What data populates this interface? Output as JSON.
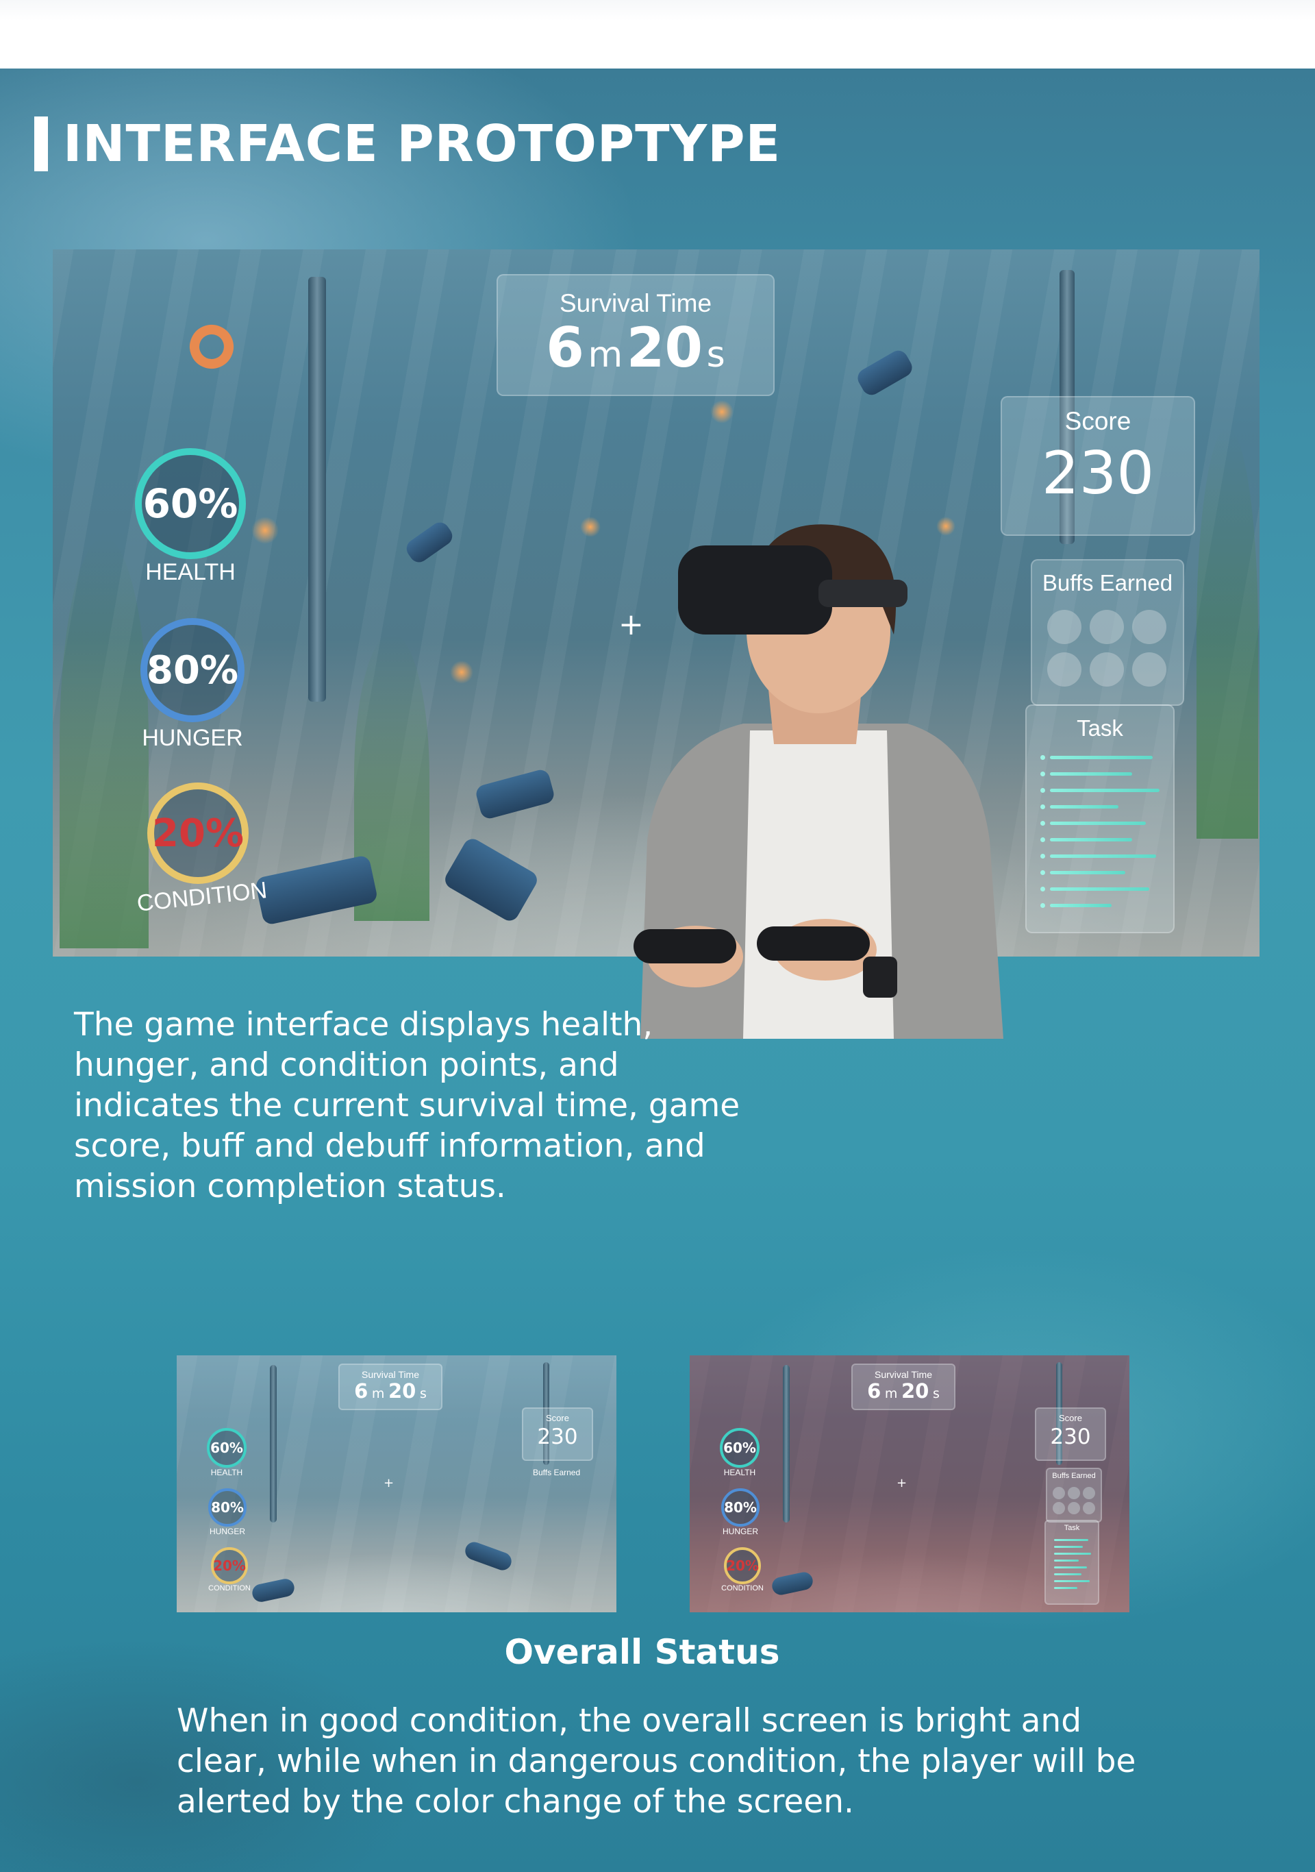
{
  "header": {
    "title": "INTERFACE PROTOPTYPE"
  },
  "main_hud": {
    "survival_label": "Survival Time",
    "minutes": "6",
    "minutes_unit": "m",
    "seconds": "20",
    "seconds_unit": "s",
    "score_label": "Score",
    "score_value": "230",
    "buffs_label": "Buffs Earned",
    "task_label": "Task",
    "stats": [
      {
        "label": "HEALTH",
        "value": "60%",
        "color": "#3fd0c4"
      },
      {
        "label": "HUNGER",
        "value": "80%",
        "color": "#4f8fd6"
      },
      {
        "label": "CONDITION",
        "value": "20%",
        "color": "#e8c66a",
        "value_color": "#d2383a"
      }
    ]
  },
  "description": "The game interface displays health, hunger, and condition points, and indicates the current survival time, game score, buff and debuff information, and mission completion status.",
  "thumbnails": [
    {
      "state": "good",
      "survival_label": "Survival Time",
      "minutes": "6",
      "minutes_unit": "m",
      "seconds": "20",
      "seconds_unit": "s",
      "score_label": "Score",
      "score_value": "230",
      "buffs_label": "Buffs Earned",
      "stats": [
        {
          "label": "HEALTH",
          "value": "60%"
        },
        {
          "label": "HUNGER",
          "value": "80%"
        },
        {
          "label": "CONDITION",
          "value": "20%"
        }
      ]
    },
    {
      "state": "danger",
      "survival_label": "Survival Time",
      "minutes": "6",
      "minutes_unit": "m",
      "seconds": "20",
      "seconds_unit": "s",
      "score_label": "Score",
      "score_value": "230",
      "buffs_label": "Buffs Earned",
      "task_label": "Task",
      "stats": [
        {
          "label": "HEALTH",
          "value": "60%"
        },
        {
          "label": "HUNGER",
          "value": "80%"
        },
        {
          "label": "CONDITION",
          "value": "20%"
        }
      ]
    }
  ],
  "overall_status": {
    "heading": "Overall Status",
    "text": "When in good condition, the overall screen is bright and clear, while when in dangerous condition, the player will be alerted by the color change of the screen."
  }
}
